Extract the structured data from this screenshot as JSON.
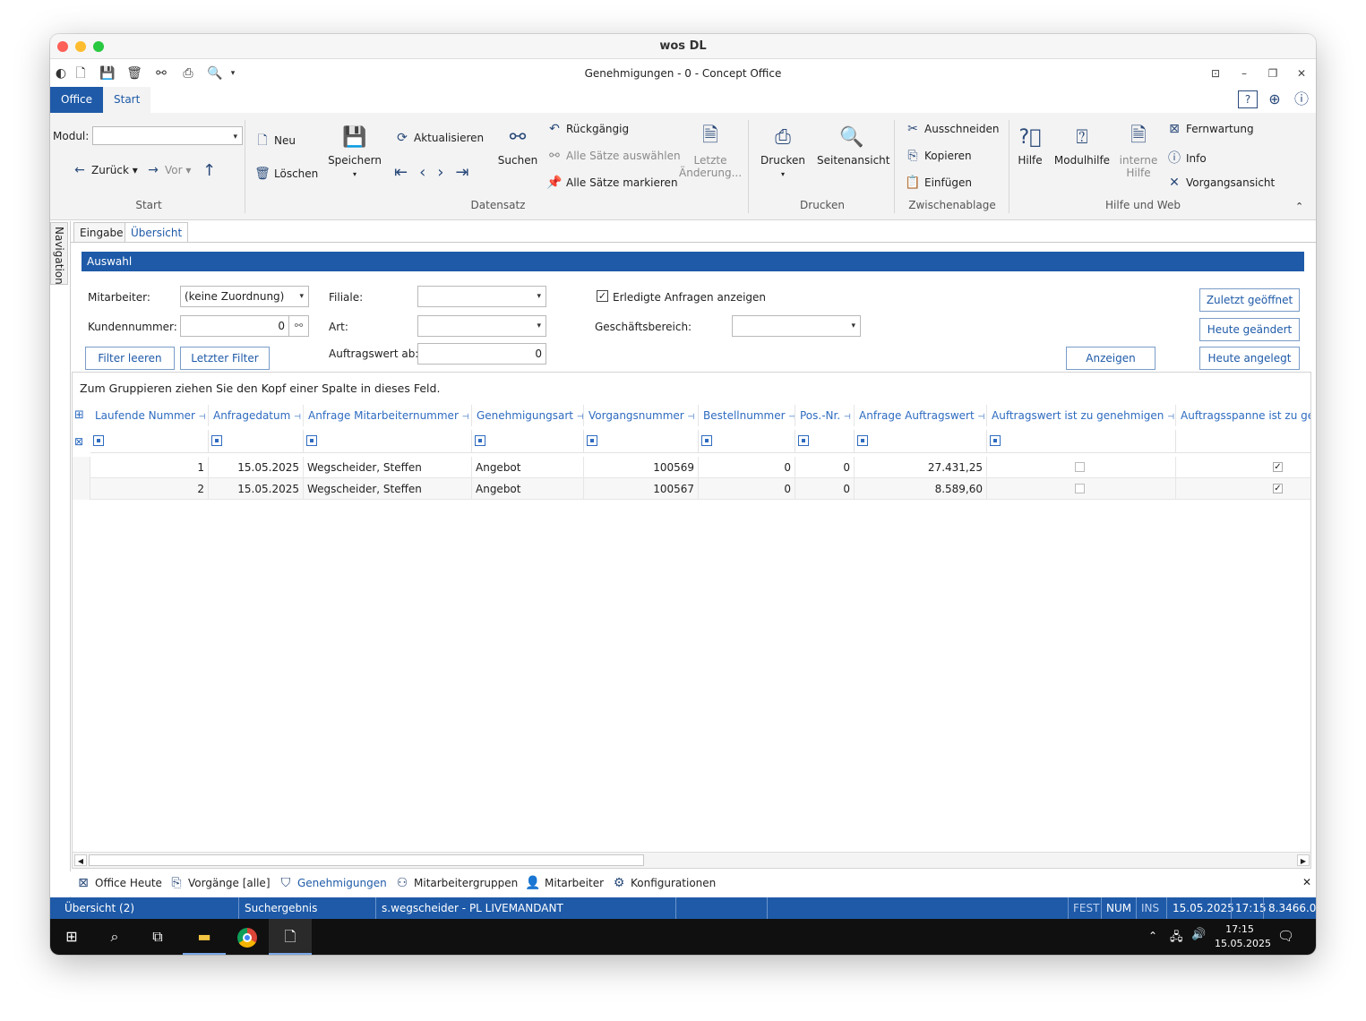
{
  "mac_title": "wos DL",
  "app_title": "Genehmigungen - 0 - Concept Office",
  "tabs": {
    "office": "Office",
    "start": "Start"
  },
  "ribbon": {
    "modul_label": "Modul:",
    "zurueck": "Zurück",
    "vor": "Vor",
    "group_start": "Start",
    "neu": "Neu",
    "loeschen": "Löschen",
    "speichern": "Speichern",
    "aktualisieren": "Aktualisieren",
    "suchen": "Suchen",
    "rueckgaengig": "Rückgängig",
    "alle_auswaehlen": "Alle Sätze auswählen",
    "alle_markieren": "Alle Sätze markieren",
    "letzte_aenderung_1": "Letzte",
    "letzte_aenderung_2": "Änderung...",
    "group_datensatz": "Datensatz",
    "drucken": "Drucken",
    "seitenansicht": "Seitenansicht",
    "group_drucken": "Drucken",
    "ausschneiden": "Ausschneiden",
    "kopieren": "Kopieren",
    "einfuegen": "Einfügen",
    "group_zwischenablage": "Zwischenablage",
    "hilfe": "Hilfe",
    "modulhilfe": "Modulhilfe",
    "interne_hilfe_1": "interne",
    "interne_hilfe_2": "Hilfe",
    "fernwartung": "Fernwartung",
    "info": "Info",
    "vorgangsansicht": "Vorgangsansicht",
    "group_hilfe": "Hilfe und Web"
  },
  "nav_label": "Navigation",
  "subtabs": {
    "eingabe": "Eingabe",
    "uebersicht": "Übersicht"
  },
  "auswahl": "Auswahl",
  "filter": {
    "mitarbeiter_label": "Mitarbeiter:",
    "mitarbeiter_value": "(keine Zuordnung)",
    "kundennummer_label": "Kundennummer:",
    "kundennummer_value": "0",
    "filiale_label": "Filiale:",
    "art_label": "Art:",
    "auftragswert_label": "Auftragswert ab:",
    "auftragswert_value": "0",
    "erledigte_label": "Erledigte Anfragen anzeigen",
    "geschaeftsbereich_label": "Geschäftsbereich:",
    "filter_leeren": "Filter leeren",
    "letzter_filter": "Letzter Filter",
    "anzeigen": "Anzeigen",
    "zuletzt_geoeffnet": "Zuletzt geöffnet",
    "heute_geaendert": "Heute geändert",
    "heute_angelegt": "Heute angelegt"
  },
  "grid": {
    "group_hint": "Zum Gruppieren ziehen Sie den Kopf einer Spalte in dieses Feld.",
    "columns": [
      "Laufende Nummer",
      "Anfragedatum",
      "Anfrage Mitarbeiternummer",
      "Genehmigungsart",
      "Vorgangsnummer",
      "Bestellnummer",
      "Pos.-Nr.",
      "Anfrage Auftragswert",
      "Auftragswert ist zu genehmigen",
      "Auftragsspanne ist zu gen"
    ],
    "rows": [
      {
        "nr": "1",
        "datum": "15.05.2025",
        "mitarbeiter": "Wegscheider, Steffen",
        "art": "Angebot",
        "vorgang": "100569",
        "bestell": "0",
        "pos": "0",
        "wert": "27.431,25",
        "zu_genehmigen": false,
        "spanne": true
      },
      {
        "nr": "2",
        "datum": "15.05.2025",
        "mitarbeiter": "Wegscheider, Steffen",
        "art": "Angebot",
        "vorgang": "100567",
        "bestell": "0",
        "pos": "0",
        "wert": "8.589,60",
        "zu_genehmigen": false,
        "spanne": true
      }
    ]
  },
  "bottom_tabs": [
    "Office Heute",
    "Vorgänge [alle]",
    "Genehmigungen",
    "Mitarbeitergruppen",
    "Mitarbeiter",
    "Konfigurationen"
  ],
  "status": {
    "uebersicht": "Übersicht (2)",
    "suchergebnis": "Suchergebnis",
    "user": "s.wegscheider - PL LIVEMANDANT",
    "fest": "FEST",
    "num": "NUM",
    "ins": "INS",
    "date": "15.05.2025",
    "time": "17:15",
    "version": "8.3466.0"
  },
  "taskbar": {
    "time": "17:15",
    "date": "15.05.2025"
  },
  "colors": {
    "accent": "#1e5aa8",
    "link": "#2e6bc0"
  }
}
